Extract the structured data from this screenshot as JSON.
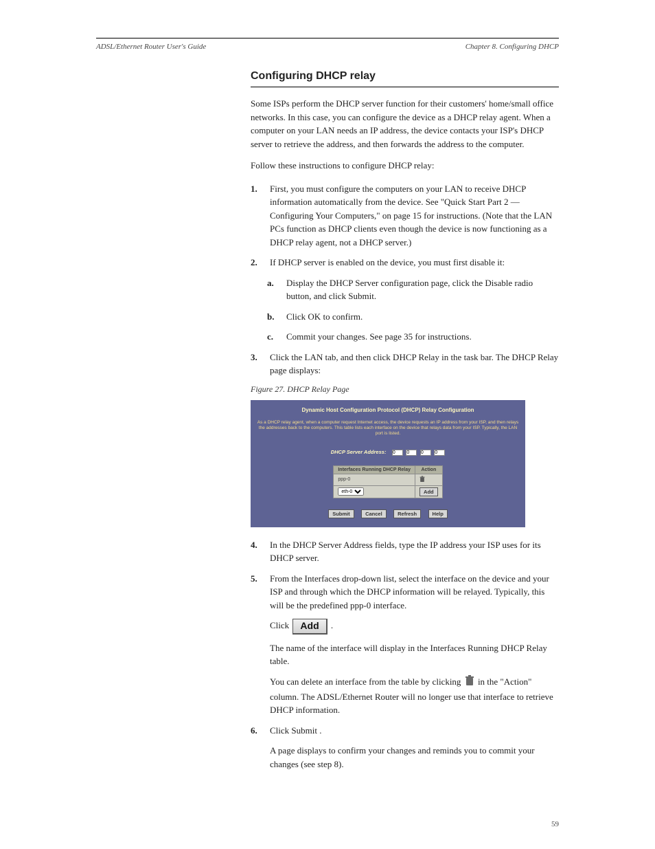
{
  "running_head": {
    "left": "ADSL/Ethernet Router User's Guide",
    "right": "Chapter 8. Configuring DHCP"
  },
  "section": {
    "heading": "Configuring DHCP relay",
    "para1": "Some ISPs perform the DHCP server function for their customers' home/small office networks. In this case, you can configure the device as a DHCP relay agent. When a computer on your LAN needs an IP address, the device contacts your ISP's DHCP server to retrieve the address, and then forwards the address to the computer.",
    "para2": "Follow these instructions to configure DHCP relay:"
  },
  "steps": [
    {
      "n": "1.",
      "body": "First, you must configure the computers on your LAN to receive DHCP information automatically from the device. See \"Quick Start Part 2 — Configuring Your Computers,\" on page 15 for instructions. (Note that the LAN PCs function as DHCP clients even though the device is now functioning as a DHCP relay agent, not a DHCP server.)"
    },
    {
      "n": "2.",
      "body": "If DHCP server is enabled on the device, you must first disable it:"
    },
    {
      "n": "a.",
      "body": "Display the DHCP Server configuration page, click the Disable radio button, and click"
    },
    {
      "n": "b.",
      "body": "Click"
    },
    {
      "n": "c.",
      "body": "Commit your changes. See page 35 for instructions."
    },
    {
      "n": "3.",
      "body": "Click the LAN tab, and then click DHCP Relay in the task bar. The DHCP Relay page displays:"
    }
  ],
  "steps_tail": {
    "submit_suffix": ".",
    "ok_confirm": " to confirm."
  },
  "figure": {
    "caption": "Figure 27. DHCP Relay Page"
  },
  "shot": {
    "title": "Dynamic Host Configuration Protocol (DHCP) Relay Configuration",
    "desc": "As a DHCP relay agent, when a computer request Internet access, the device requests an IP address from your ISP, and then relays the addresses back to the computers. This table lists each interface on the device that relays data from your ISP. Typically, the LAN port is listed.",
    "addr_label": "DHCP Server Address:",
    "ip": [
      "0",
      "0",
      "0",
      "0"
    ],
    "table": {
      "headers": [
        "Interfaces Running DHCP Relay",
        "Action"
      ],
      "row_iface": "ppp-0",
      "select_value": "eth-0",
      "add_btn": "Add"
    },
    "buttons": [
      "Submit",
      "Cancel",
      "Refresh",
      "Help"
    ]
  },
  "post_steps": [
    {
      "n": "4.",
      "body": "In the DHCP Server Address fields, type the IP address your ISP uses for its DHCP server."
    },
    {
      "n": "5.",
      "body": "From the Interfaces drop-down list, select the interface on the device and your ISP and through which the DHCP information will be relayed. Typically, this will be the predefined ppp-0 interface."
    },
    {
      "n": "",
      "body_prefix": "Click ",
      "body_suffix": "."
    },
    {
      "n": "",
      "body": "The name of the interface will display in the Interfaces Running DHCP Relay table."
    },
    {
      "n": "",
      "body_prefix": "You can delete an interface from the table by clicking ",
      "body_suffix": " in the \"Action\" column. The ADSL/Ethernet Router will no longer use that interface to retrieve DHCP information."
    },
    {
      "n": "6.",
      "body_prefix": "Click ",
      "body_suffix": ".",
      "submit": true
    },
    {
      "n": "",
      "body": "A page displays to confirm your changes and reminds you to commit your changes (see step 8)."
    }
  ],
  "inline": {
    "add_label": "Add",
    "submit_word": "Submit",
    "ok_word": "OK"
  },
  "page_number": "59"
}
